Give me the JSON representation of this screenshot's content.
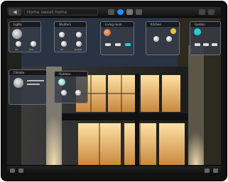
{
  "topbar": {
    "back_label": "◀",
    "title": "Home sweet home"
  },
  "cards": [
    {
      "label": "Lights",
      "a": "ON",
      "b": "DIM"
    },
    {
      "label": "Shutters",
      "a": "UP",
      "b": "DOWN"
    },
    {
      "label": "Living room",
      "a": "",
      "b": ""
    },
    {
      "label": "Kitchen",
      "a": "",
      "b": ""
    },
    {
      "label": "Garden",
      "a": "",
      "b": ""
    },
    {
      "label": "Climate",
      "a": "",
      "b": ""
    },
    {
      "label": "Outdoor",
      "a": "",
      "b": ""
    }
  ],
  "colors": {
    "accent": "#1e90ff",
    "warm_light": "#ffd27a",
    "glass_panel": "#3a3f47"
  }
}
